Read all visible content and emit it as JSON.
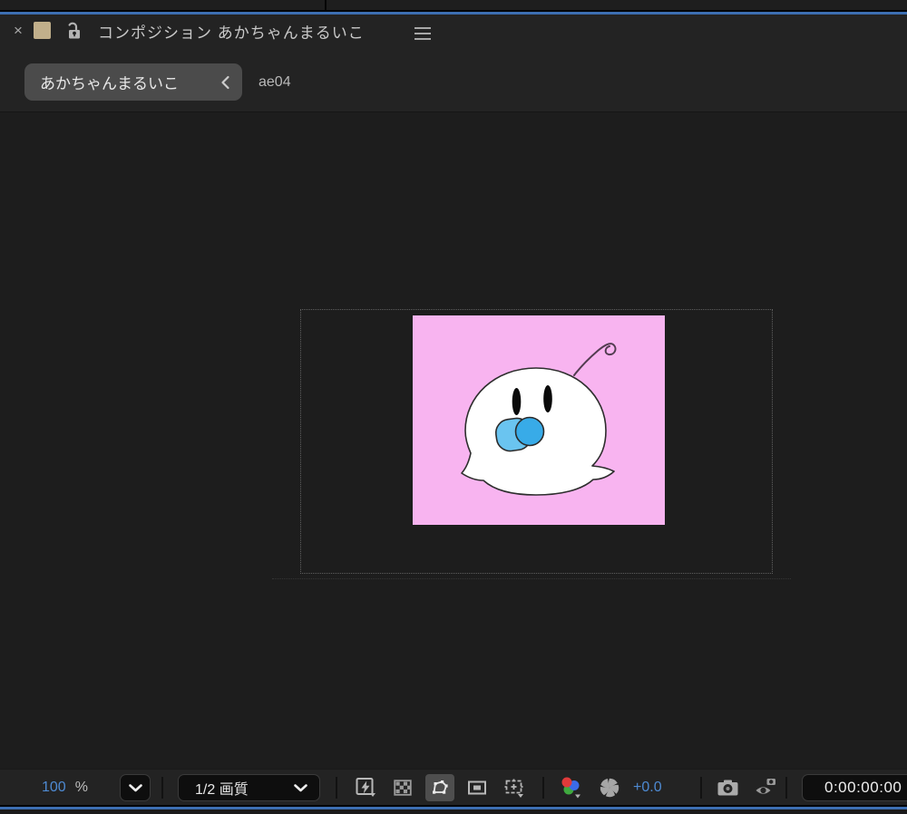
{
  "tab": {
    "close": "×",
    "title": "コンポジション あかちゃんまるいこ",
    "swatch_color": "#C1AF8B",
    "lock_state": "unlocked"
  },
  "breadcrumb": {
    "current": "あかちゃんまるいこ",
    "parent": "ae04"
  },
  "viewer": {
    "comp_background_color": "#F8B4F0",
    "viewer_background_color": "#1D1D1D",
    "content_description": "white round baby ghost character with black oval eyes, blue pacifier and curly antenna, inside dotted region-of-interest rectangle"
  },
  "toolbar": {
    "magnification": "100",
    "magnification_unit": "%",
    "resolution": "1/2 画質",
    "exposure": "+0.0",
    "timecode": "0:00:00:00"
  },
  "colors": {
    "active_panel_border_blue": "#3D6FB3",
    "value_text_blue": "#4E8AD2",
    "panel_background": "#232323",
    "breadcrumb_pill": "#4B4B4B"
  },
  "icons": {
    "tab_close": "x-glyph",
    "color_swatch": "tan-square",
    "lock": "open-padlock",
    "panel_menu": "hamburger",
    "breadcrumb_back": "chevron-left",
    "magnification_dropdown": "chevron-down",
    "resolution_dropdown": "chevron-down",
    "fast_previews": "lightning-in-square",
    "transparency_grid": "checkerboard",
    "mask_path_visibility": "polygon-with-vertices (active)",
    "region_of_interest": "square-in-square",
    "grid_guides": "crosshair-box",
    "channels_color_mgmt": "rgb-circles",
    "exposure": "aperture-pinwheel",
    "take_snapshot": "camera",
    "show_snapshot": "eye-with-camera"
  }
}
